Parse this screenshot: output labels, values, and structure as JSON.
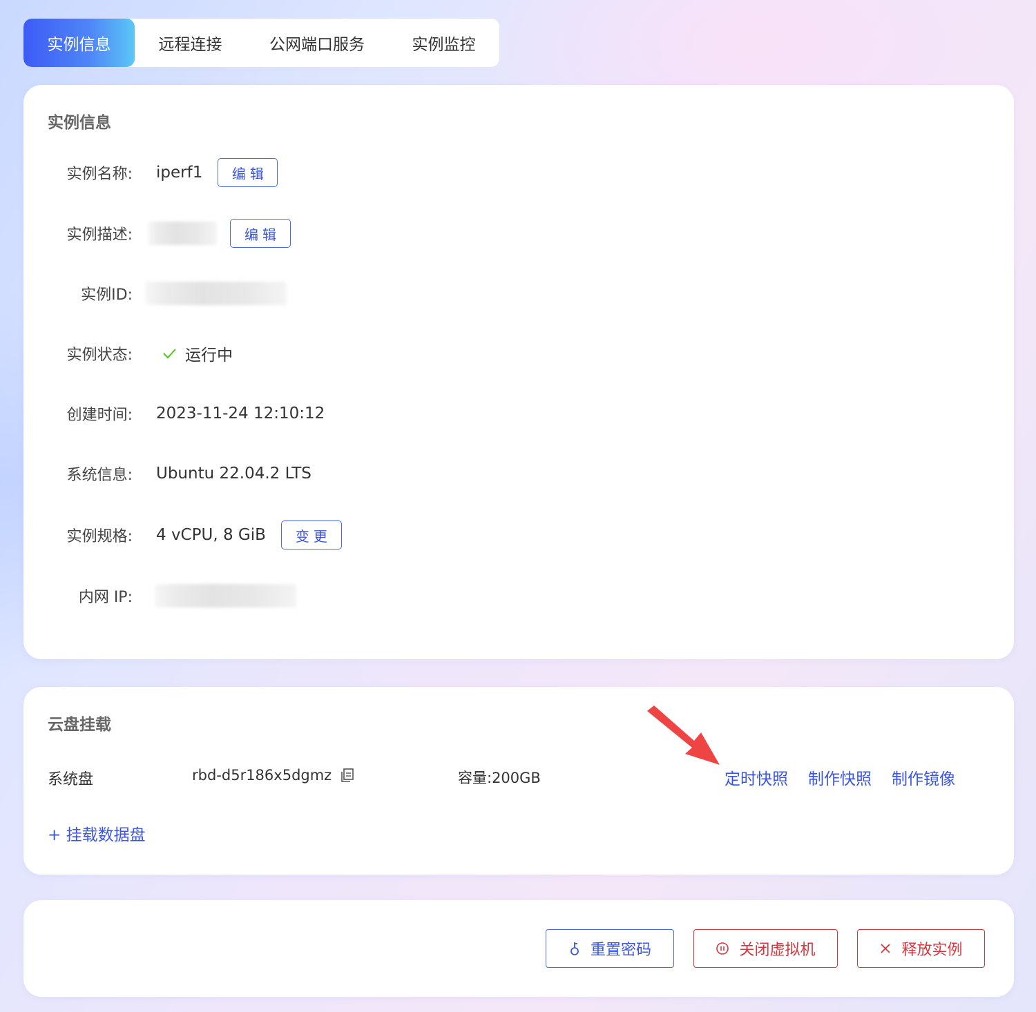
{
  "tabs": [
    {
      "label": "实例信息",
      "active": true
    },
    {
      "label": "远程连接",
      "active": false
    },
    {
      "label": "公网端口服务",
      "active": false
    },
    {
      "label": "实例监控",
      "active": false
    }
  ],
  "instance_info": {
    "title": "实例信息",
    "name_label": "实例名称:",
    "name_value": "iperf1",
    "edit_label": "编辑",
    "desc_label": "实例描述:",
    "id_label": "实例ID:",
    "status_label": "实例状态:",
    "status_value": "运行中",
    "created_label": "创建时间:",
    "created_value": "2023-11-24 12:10:12",
    "system_label": "系统信息:",
    "system_value": "Ubuntu 22.04.2 LTS",
    "spec_label": "实例规格:",
    "spec_value": "4 vCPU, 8 GiB",
    "change_label": "变更",
    "ip_label": "内网 IP:"
  },
  "disk": {
    "title": "云盘挂载",
    "type_label": "系统盘",
    "disk_id": "rbd-d5r186x5dgmz",
    "capacity": "容量:200GB",
    "actions": [
      "定时快照",
      "制作快照",
      "制作镜像"
    ],
    "mount_label": "+ 挂载数据盘"
  },
  "footer_actions": {
    "reset_password": "重置密码",
    "shutdown": "关闭虚拟机",
    "release": "释放实例"
  },
  "colors": {
    "accent": "#3b56e0",
    "danger": "#d9363e",
    "success": "#52c41a",
    "annotation_arrow": "#ef4444"
  }
}
